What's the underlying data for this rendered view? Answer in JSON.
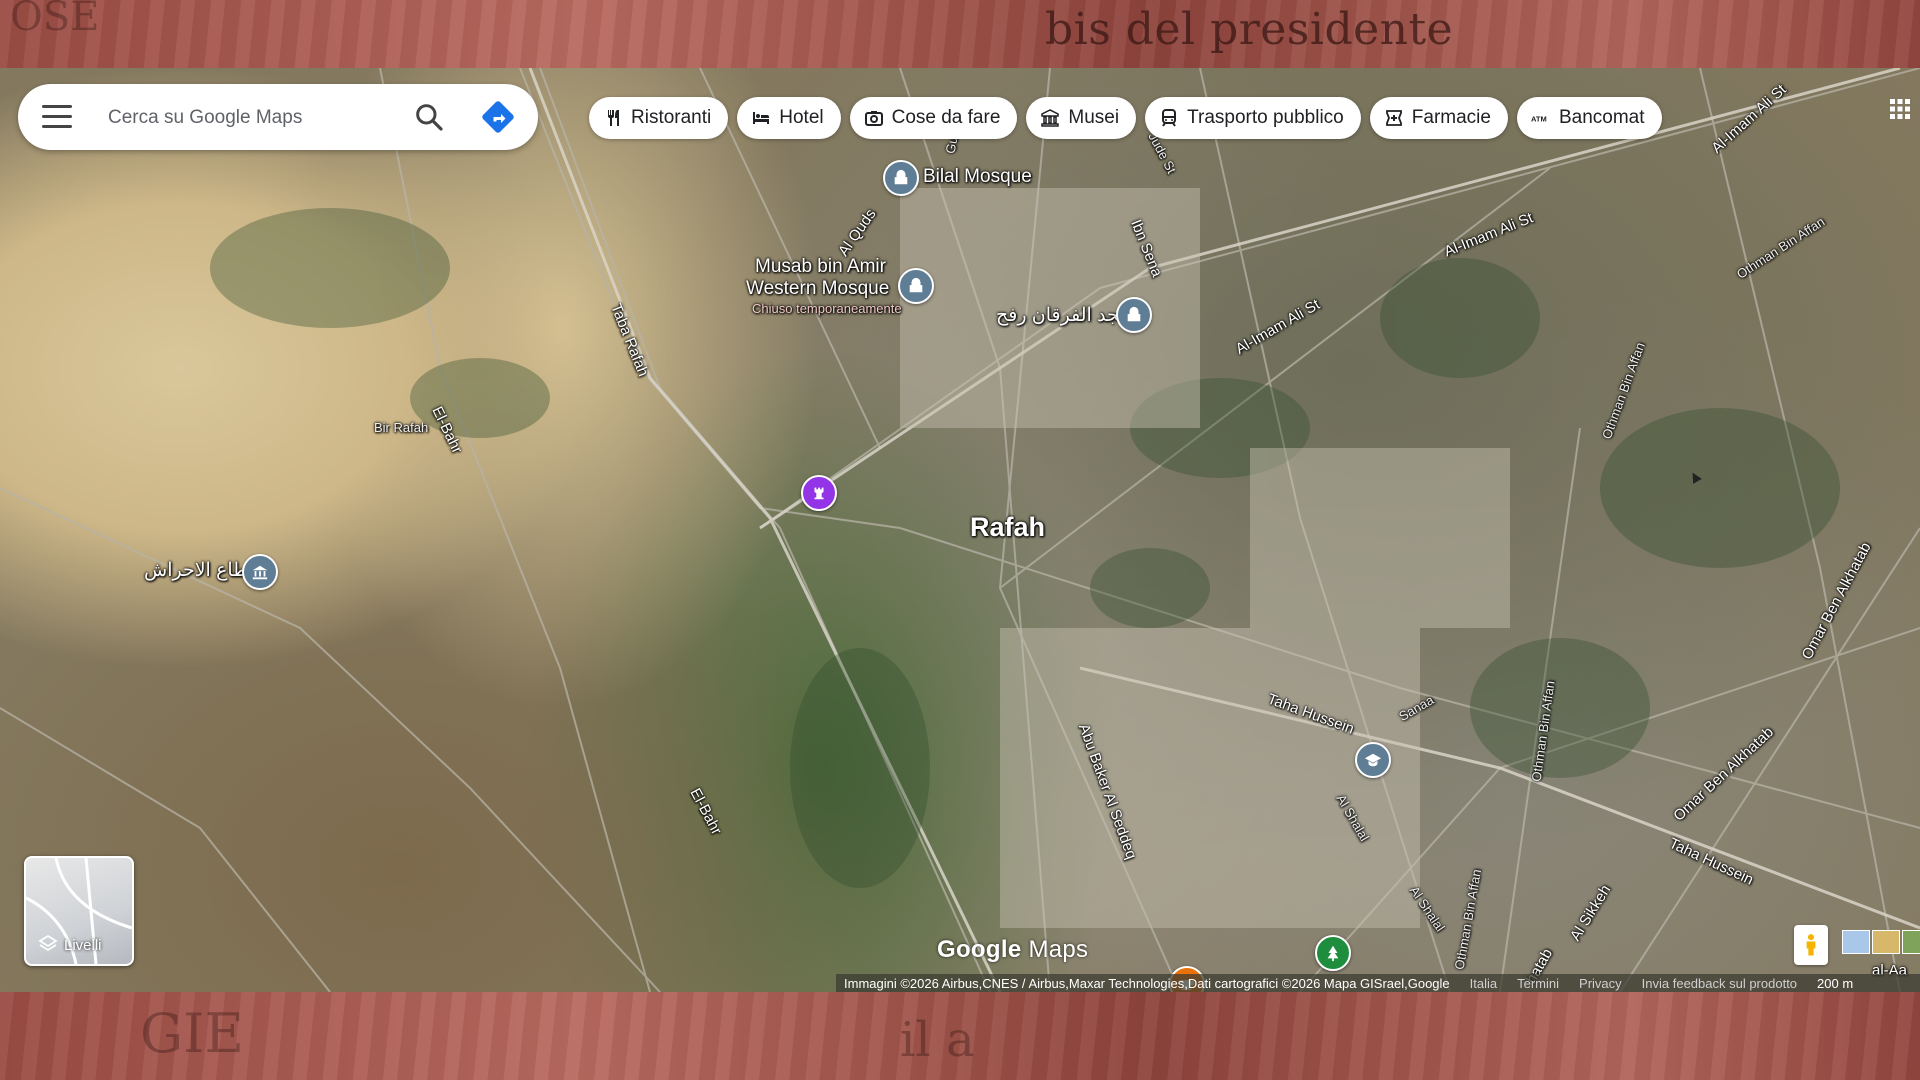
{
  "backdrop": {
    "headline": "bis del presidente"
  },
  "search": {
    "placeholder": "Cerca su Google Maps",
    "menu_icon": "menu-icon",
    "search_icon": "search-icon",
    "directions_icon": "directions-icon"
  },
  "chips": [
    {
      "label": "Ristoranti",
      "icon": "restaurant-icon"
    },
    {
      "label": "Hotel",
      "icon": "hotel-icon"
    },
    {
      "label": "Cose da fare",
      "icon": "camera-icon"
    },
    {
      "label": "Musei",
      "icon": "museum-icon"
    },
    {
      "label": "Trasporto pubblico",
      "icon": "transit-icon"
    },
    {
      "label": "Farmacie",
      "icon": "pharmacy-icon"
    },
    {
      "label": "Bancomat",
      "icon": "atm-icon"
    }
  ],
  "map": {
    "city": "Rafah",
    "places": {
      "bilal": "Bilal Mosque",
      "musab_1": "Musab bin Amir",
      "musab_2": "Western Mosque",
      "musab_status": "Chiuso temporaneamente",
      "furqan": "مسجد الفرقان رفح",
      "ahrash": "قطاع الاحراش",
      "bir_rafah": "Bir Rafah"
    },
    "roads": {
      "al_quds": "Al Quds",
      "ibn_sena": "Ibn Sena",
      "taba_rafah": "Taba Rafah",
      "el_bahr_1": "El-Bahr",
      "el_bahr_2": "El-Bahr",
      "imam_ali_1": "Al-Imam Ali St",
      "imam_ali_2": "Al-Imam Ali St",
      "imam_ali_3": "Al-Imam Ali St",
      "othman_1": "Othman Bin Affan",
      "othman_2": "Othman Bin Affan",
      "othman_3": "Othman Bin Affan",
      "othman_4": "Othman Bin Affan",
      "omar_1": "Omar Ben Alkhatab",
      "omar_2": "Omar Ben Alkhatab",
      "taha_1": "Taha Hussein",
      "taha_2": "Taha Hussein",
      "sanaa": "Sanaa",
      "abu_baker": "Abu Baker Al Seddeq",
      "shalal_1": "Al Shalal",
      "shalal_2": "Al Shalal",
      "sikkeh": "Al Sikkeh",
      "khatab_cut": "hatab",
      "al_aa": "al-Aa",
      "side_st": "Jude St",
      "gu": "Gu"
    }
  },
  "layers": {
    "label": "Livelli",
    "icon": "layers-icon"
  },
  "logo": {
    "google": "Google",
    "maps": "Maps"
  },
  "attribution": {
    "imagery": "Immagini ©2026 Airbus,CNES / Airbus,Maxar Technologies,Dati cartografici ©2026 Mapa GISrael,Google",
    "links": [
      "Italia",
      "Termini",
      "Privacy",
      "Invia feedback sul prodotto"
    ],
    "scale": "200 m"
  },
  "colors": {
    "directions_blue": "#1a73e8",
    "mosque_pin": "#5f7d95",
    "school_pin": "#5f7d95",
    "attraction_pin": "#9334e6",
    "cafe_pin": "#e8710a",
    "park_pin": "#1e8e3e"
  }
}
